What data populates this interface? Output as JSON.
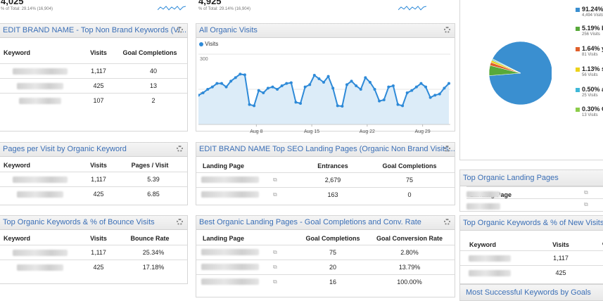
{
  "top_scorecards": {
    "left_value": "4,025",
    "left_subtext": "% of Total: 29.14% (16,904)",
    "mid_value": "4,925",
    "mid_subtext": "% of Total: 29.14% (16,904)"
  },
  "nonbrand": {
    "title": "EDIT BRAND NAME - Top Non Brand Keywords (Vi...",
    "headers": [
      "Keyword",
      "Visits",
      "Goal Completions"
    ],
    "rows": [
      {
        "visits": "1,117",
        "goals": "40"
      },
      {
        "visits": "425",
        "goals": "13"
      },
      {
        "visits": "107",
        "goals": "2"
      }
    ]
  },
  "pages_per_visit": {
    "title": "Pages per Visit by Organic Keyword",
    "headers": [
      "Keyword",
      "Visits",
      "Pages / Visit"
    ],
    "rows": [
      {
        "visits": "1,117",
        "value": "5.39"
      },
      {
        "visits": "425",
        "value": "6.85"
      }
    ]
  },
  "bounce": {
    "title": "Top Organic Keywords & % of Bounce Visits",
    "headers": [
      "Keyword",
      "Visits",
      "Bounce Rate"
    ],
    "rows": [
      {
        "visits": "1,117",
        "value": "25.34%"
      },
      {
        "visits": "425",
        "value": "17.18%"
      }
    ]
  },
  "organic_visits": {
    "title": "All Organic Visits",
    "legend": "Visits"
  },
  "chart_data": {
    "type": "area",
    "series": [
      {
        "name": "Visits",
        "values": [
          125,
          135,
          150,
          160,
          175,
          175,
          160,
          185,
          200,
          215,
          212,
          85,
          80,
          145,
          135,
          155,
          160,
          150,
          165,
          175,
          178,
          95,
          90,
          160,
          170,
          210,
          195,
          180,
          205,
          155,
          80,
          78,
          170,
          185,
          165,
          150,
          200,
          180,
          150,
          100,
          105,
          160,
          165,
          85,
          80,
          135,
          145,
          160,
          175,
          160,
          115,
          125,
          130,
          155,
          175
        ]
      }
    ],
    "categories": [
      "Aug 8",
      "Aug 15",
      "Aug 22",
      "Aug 29"
    ],
    "ylim": [
      0,
      300
    ],
    "yticks": [
      150,
      300
    ],
    "color": "#2e8ad8",
    "fill": "#dcecf8"
  },
  "landing_nonbrand": {
    "title": "EDIT BRAND NAME Top SEO Landing Pages (Organic Non Brand Visits...",
    "headers": [
      "Landing Page",
      "Entrances",
      "Goal Completions"
    ],
    "rows": [
      {
        "entrances": "2,679",
        "goals": "75"
      },
      {
        "entrances": "163",
        "goals": "0"
      }
    ]
  },
  "best_landing": {
    "title": "Best Organic Landing Pages - Goal Completions and Conv. Rate",
    "headers": [
      "Landing Page",
      "Goal Completions",
      "Goal Conversion Rate"
    ],
    "rows": [
      {
        "goals": "75",
        "rate": "2.80%"
      },
      {
        "goals": "20",
        "rate": "13.79%"
      },
      {
        "goals": "16",
        "rate": "100.00%"
      }
    ]
  },
  "pie": {
    "slices": [
      {
        "pct": "91.24%",
        "label_start": "91.24%",
        "sub": "4,494 Visits",
        "color": "#3a8fd0",
        "value": 91.24
      },
      {
        "pct": "5.19%",
        "label_start": "5.19% b",
        "sub": "256 Visits",
        "color": "#58a93a",
        "value": 5.19
      },
      {
        "pct": "1.64%",
        "label_start": "1.64% y",
        "sub": "81 Visits",
        "color": "#e0602b",
        "value": 1.64
      },
      {
        "pct": "1.13%",
        "label_start": "1.13% s",
        "sub": "56 Visits",
        "color": "#ecd21a",
        "value": 1.13
      },
      {
        "pct": "0.50%",
        "label_start": "0.50% a",
        "sub": "25 Visits",
        "color": "#3fb8d8",
        "value": 0.5
      },
      {
        "pct": "0.30%",
        "label_start": "0.30% C",
        "sub": "13 Visits",
        "color": "#8ccc4a",
        "value": 0.3
      }
    ]
  },
  "top_landing": {
    "title": "Top Organic Landing Pages",
    "header": "Landing Page"
  },
  "new_visits": {
    "title": "Top Organic Keywords & % of New Visits",
    "headers": [
      "Keyword",
      "Visits",
      "%"
    ],
    "rows": [
      {
        "visits": "1,117"
      },
      {
        "visits": "425"
      }
    ]
  },
  "most_successful": {
    "title": "Most Successful Keywords by Goals"
  }
}
